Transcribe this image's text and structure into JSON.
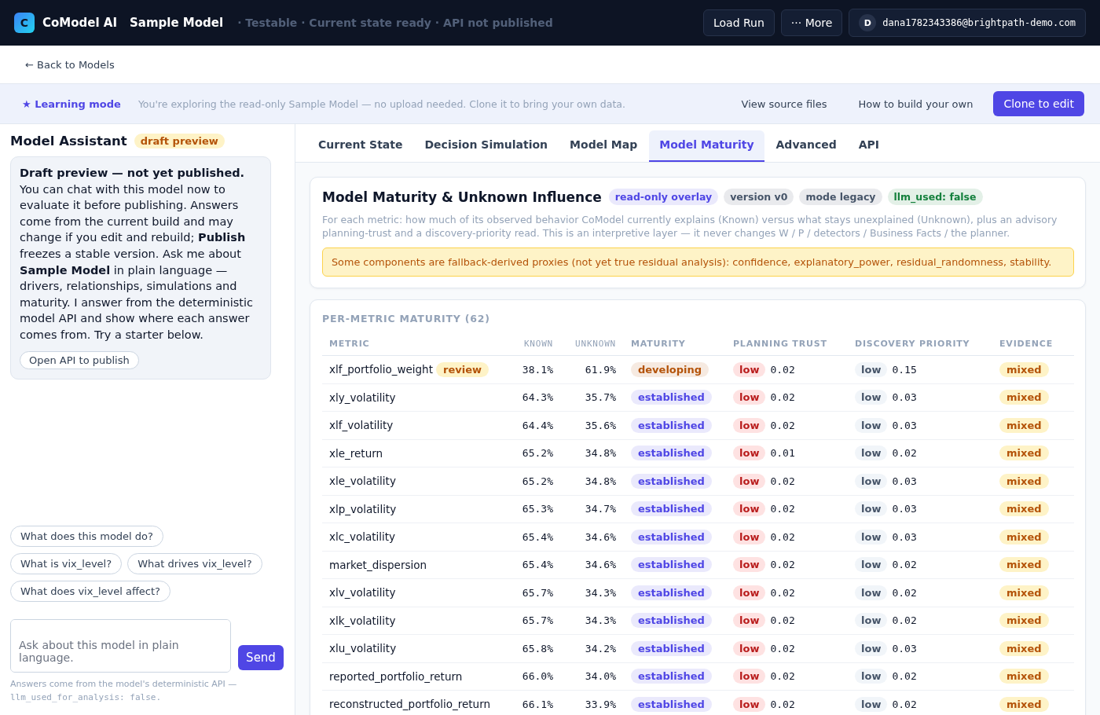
{
  "topbar": {
    "logo_letter": "C",
    "brand": "CoModel AI",
    "model": "Sample Model",
    "status": "· Testable · Current state ready · API not published",
    "buttons": [
      "Load Run",
      "··· More"
    ],
    "account": {
      "initial": "D",
      "email": "dana1782343386@brightpath-demo.com"
    }
  },
  "back_link": "← Back to Models",
  "banner": {
    "label": "★ Learning mode",
    "text": "You're exploring the read-only Sample Model — no upload needed. Clone it to bring your own data.",
    "links": [
      "View source files",
      "How to build your own"
    ],
    "primary": "Clone to edit"
  },
  "assistant": {
    "title": "Model Assistant",
    "badge": "draft preview",
    "message": "**Draft preview — not yet published.** You can chat with this model now to evaluate it before publishing. Answers come from the current build and may change if you edit and rebuild; **Publish** freezes a stable version. Ask me about **Sample Model** in plain language — drivers, relationships, simulations and maturity. I answer from the deterministic model API and show where each answer comes from. Try a starter below.",
    "message_button": "Open API to publish",
    "starters": [
      "What does this model do?",
      "What is vix_level?",
      "What drives vix_level?",
      "What does vix_level affect?"
    ],
    "input": {
      "placeholder": "Ask about this model in plain language."
    },
    "send": "Send",
    "footnote": "Answers come from the model's deterministic API —",
    "footnote_code": "llm_used_for_analysis: false."
  },
  "tabs": [
    {
      "label": "Current State",
      "selected": false
    },
    {
      "label": "Decision Simulation",
      "selected": false
    },
    {
      "label": "Model Map",
      "selected": false
    },
    {
      "label": "Model Maturity",
      "selected": true
    },
    {
      "label": "Advanced",
      "selected": false
    },
    {
      "label": "API",
      "selected": false
    }
  ],
  "overview": {
    "title": "Model Maturity & Unknown Influence",
    "tags": [
      {
        "label": "read-only overlay",
        "color": "#4f46e5"
      },
      {
        "label": "version v0",
        "color": "#475569"
      },
      {
        "label": "mode legacy",
        "color": "#475569"
      },
      {
        "label": "llm_used: false",
        "color": "#15803d"
      }
    ],
    "description": "For each metric: how much of its observed behavior CoModel currently explains (Known) versus what stays unexplained (Unknown), plus an advisory planning-trust and a discovery-priority read. This is an interpretive layer — it never changes W / P / detectors / Business Facts / the planner.",
    "warning": "Some components are fallback-derived proxies (not yet true residual analysis): confidence, explanatory_power, residual_randomness, stability."
  },
  "table": {
    "title": "PER-METRIC MATURITY (62)",
    "columns": [
      "METRIC",
      "KNOWN",
      "UNKNOWN",
      "MATURITY",
      "PLANNING TRUST",
      "DISCOVERY PRIORITY",
      "EVIDENCE"
    ],
    "rows": [
      {
        "metric": "xlf_portfolio_weight",
        "flag": "review",
        "known": "38.1%",
        "unknown": "61.9%",
        "maturity": {
          "label": "developing",
          "color": "#b45309"
        },
        "trust": "low",
        "trust_value": "0.02",
        "priority": "low",
        "priority_value": "0.15",
        "evidence": "mixed"
      },
      {
        "metric": "xly_volatility",
        "known": "64.3%",
        "unknown": "35.7%",
        "maturity": {
          "label": "established",
          "color": "#4f46e5"
        },
        "trust": "low",
        "trust_value": "0.02",
        "priority": "low",
        "priority_value": "0.03",
        "evidence": "mixed"
      },
      {
        "metric": "xlf_volatility",
        "known": "64.4%",
        "unknown": "35.6%",
        "maturity": {
          "label": "established",
          "color": "#4f46e5"
        },
        "trust": "low",
        "trust_value": "0.02",
        "priority": "low",
        "priority_value": "0.03",
        "evidence": "mixed"
      },
      {
        "metric": "xle_return",
        "known": "65.2%",
        "unknown": "34.8%",
        "maturity": {
          "label": "established",
          "color": "#4f46e5"
        },
        "trust": "low",
        "trust_value": "0.01",
        "priority": "low",
        "priority_value": "0.02",
        "evidence": "mixed"
      },
      {
        "metric": "xle_volatility",
        "known": "65.2%",
        "unknown": "34.8%",
        "maturity": {
          "label": "established",
          "color": "#4f46e5"
        },
        "trust": "low",
        "trust_value": "0.02",
        "priority": "low",
        "priority_value": "0.03",
        "evidence": "mixed"
      },
      {
        "metric": "xlp_volatility",
        "known": "65.3%",
        "unknown": "34.7%",
        "maturity": {
          "label": "established",
          "color": "#4f46e5"
        },
        "trust": "low",
        "trust_value": "0.02",
        "priority": "low",
        "priority_value": "0.03",
        "evidence": "mixed"
      },
      {
        "metric": "xlc_volatility",
        "known": "65.4%",
        "unknown": "34.6%",
        "maturity": {
          "label": "established",
          "color": "#4f46e5"
        },
        "trust": "low",
        "trust_value": "0.02",
        "priority": "low",
        "priority_value": "0.03",
        "evidence": "mixed"
      },
      {
        "metric": "market_dispersion",
        "known": "65.4%",
        "unknown": "34.6%",
        "maturity": {
          "label": "established",
          "color": "#4f46e5"
        },
        "trust": "low",
        "trust_value": "0.02",
        "priority": "low",
        "priority_value": "0.02",
        "evidence": "mixed"
      },
      {
        "metric": "xlv_volatility",
        "known": "65.7%",
        "unknown": "34.3%",
        "maturity": {
          "label": "established",
          "color": "#4f46e5"
        },
        "trust": "low",
        "trust_value": "0.02",
        "priority": "low",
        "priority_value": "0.02",
        "evidence": "mixed"
      },
      {
        "metric": "xlk_volatility",
        "known": "65.7%",
        "unknown": "34.3%",
        "maturity": {
          "label": "established",
          "color": "#4f46e5"
        },
        "trust": "low",
        "trust_value": "0.02",
        "priority": "low",
        "priority_value": "0.02",
        "evidence": "mixed"
      },
      {
        "metric": "xlu_volatility",
        "known": "65.8%",
        "unknown": "34.2%",
        "maturity": {
          "label": "established",
          "color": "#4f46e5"
        },
        "trust": "low",
        "trust_value": "0.02",
        "priority": "low",
        "priority_value": "0.03",
        "evidence": "mixed"
      },
      {
        "metric": "reported_portfolio_return",
        "known": "66.0%",
        "unknown": "34.0%",
        "maturity": {
          "label": "established",
          "color": "#4f46e5"
        },
        "trust": "low",
        "trust_value": "0.02",
        "priority": "low",
        "priority_value": "0.02",
        "evidence": "mixed"
      },
      {
        "metric": "reconstructed_portfolio_return",
        "known": "66.1%",
        "unknown": "33.9%",
        "maturity": {
          "label": "established",
          "color": "#4f46e5"
        },
        "trust": "low",
        "trust_value": "0.02",
        "priority": "low",
        "priority_value": "0.02",
        "evidence": "mixed"
      }
    ]
  }
}
